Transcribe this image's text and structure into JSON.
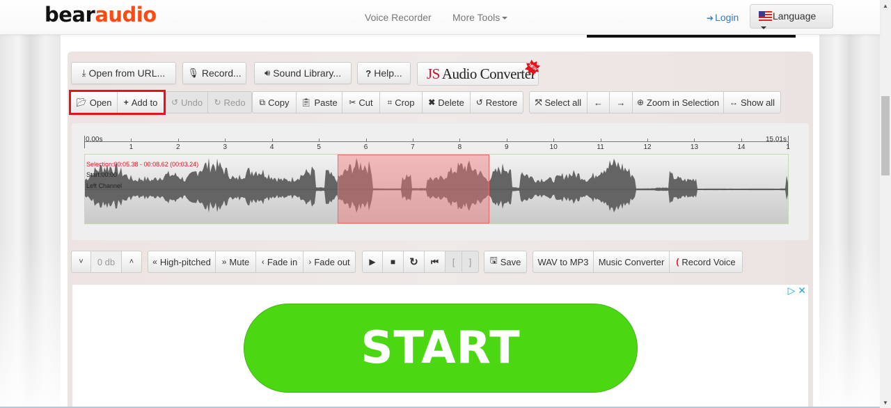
{
  "header": {
    "logo_part1": "bear",
    "logo_part2": "audio",
    "nav": [
      {
        "label": "Voice Recorder"
      },
      {
        "label": "More Tools"
      }
    ],
    "login_label": "Login",
    "language_label": "Language"
  },
  "toolbar_top": {
    "open_url": "Open from URL...",
    "record": "Record...",
    "sound_library": "Sound Library...",
    "help": "Help...",
    "js_part": "JS",
    "converter_part": "Audio Converter",
    "new_badge": "NEW"
  },
  "toolbar_edit": {
    "open": "Open",
    "add_to": "Add to",
    "undo": "Undo",
    "redo": "Redo",
    "copy": "Copy",
    "paste": "Paste",
    "cut": "Cut",
    "crop": "Crop",
    "delete": "Delete",
    "restore": "Restore",
    "select_all": "Select all",
    "arrow_left": "←",
    "arrow_right": "→",
    "zoom_selection": "Zoom in Selection",
    "show_all": "Show all"
  },
  "waveform": {
    "time_start": "0.00s",
    "time_end": "15.01s",
    "duration_s": 15.01,
    "ticks": [
      "1",
      "2",
      "3",
      "4",
      "5",
      "6",
      "7",
      "8",
      "9",
      "10",
      "11",
      "12",
      "13",
      "14",
      "1"
    ],
    "selection_text": "Selection:00:05.38 - 00:08.62 (00:03.24)",
    "selection_start_s": 5.38,
    "selection_end_s": 8.62,
    "start_text": "Start:00:00",
    "channel_text": "Left Channel",
    "colors": {
      "wave": "#646464",
      "selection": "#f07878",
      "selection_text": "#e8101a"
    }
  },
  "toolbar_bottom": {
    "vol_down": "˅",
    "db_value": "0 db",
    "vol_up": "˄",
    "high_pitched": "High-pitched",
    "mute": "Mute",
    "fade_in": "Fade in",
    "fade_out": "Fade out",
    "bracket_open": "[",
    "bracket_close": "]",
    "save": "Save",
    "wav_to_mp3": "WAV to MP3",
    "music_converter": "Music Converter",
    "record_voice": "Record Voice"
  },
  "ad": {
    "start_label": "START",
    "adchoices": "▷",
    "close": "✕",
    "accent": "#4bd711"
  },
  "colors": {
    "brand_orange": "#ff4a12",
    "link_blue": "#337ab7",
    "highlight_red": "#e8101a"
  }
}
